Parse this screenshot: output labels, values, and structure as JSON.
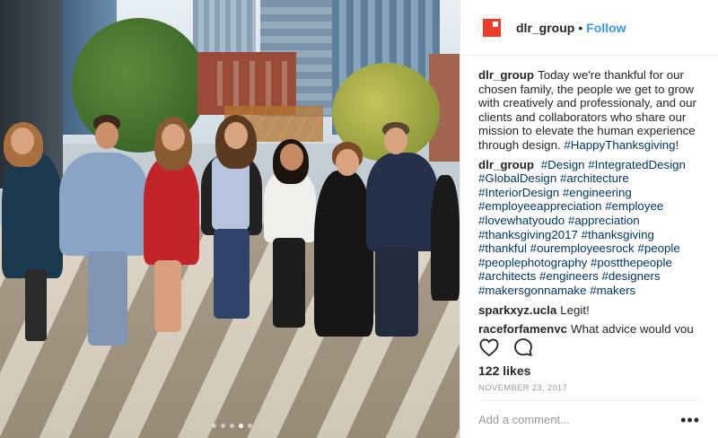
{
  "post": {
    "username": "dlr_group",
    "separator": "•",
    "follow_label": "Follow",
    "caption_user": "dlr_group",
    "caption_text": "Today we're thankful for our chosen family, the people we get to grow with creatively and professionaly, and our clients and collaborators who share our mission to elevate the human experience through design.",
    "caption_tag": "#HappyThanksgiving",
    "caption_end": "!",
    "tags_user": "dlr_group",
    "tags": [
      "#Design",
      "#IntegratedDesign",
      "#GlobalDesign",
      "#architecture",
      "#InteriorDesign",
      "#engineering",
      "#employeeappreciation",
      "#employee",
      "#lovewhatyoudo",
      "#appreciation",
      "#thanksgiving2017",
      "#thanksgiving",
      "#thankful",
      "#ouremployeesrock",
      "#people",
      "#peoplephotography",
      "#postthepeople",
      "#architects",
      "#engineers",
      "#designers",
      "#makersgonnamake",
      "#makers"
    ],
    "comment1_user": "sparkxyz.ucla",
    "comment1_text": "Legit!",
    "comment2_user": "raceforfamenyc",
    "comment2_text": "What advice would you",
    "likes": "122 likes",
    "date": "NOVEMBER 23, 2017",
    "add_comment_placeholder": "Add a comment...",
    "more_label": "•••"
  },
  "icons": {
    "heart": "heart-icon",
    "comment": "comment-icon",
    "avatar": "dlr-logo"
  },
  "colors": {
    "link": "#3897f0",
    "hashtag": "#003569",
    "brand": "#e8402b"
  },
  "carousel": {
    "count": 5,
    "active_index": 3
  }
}
